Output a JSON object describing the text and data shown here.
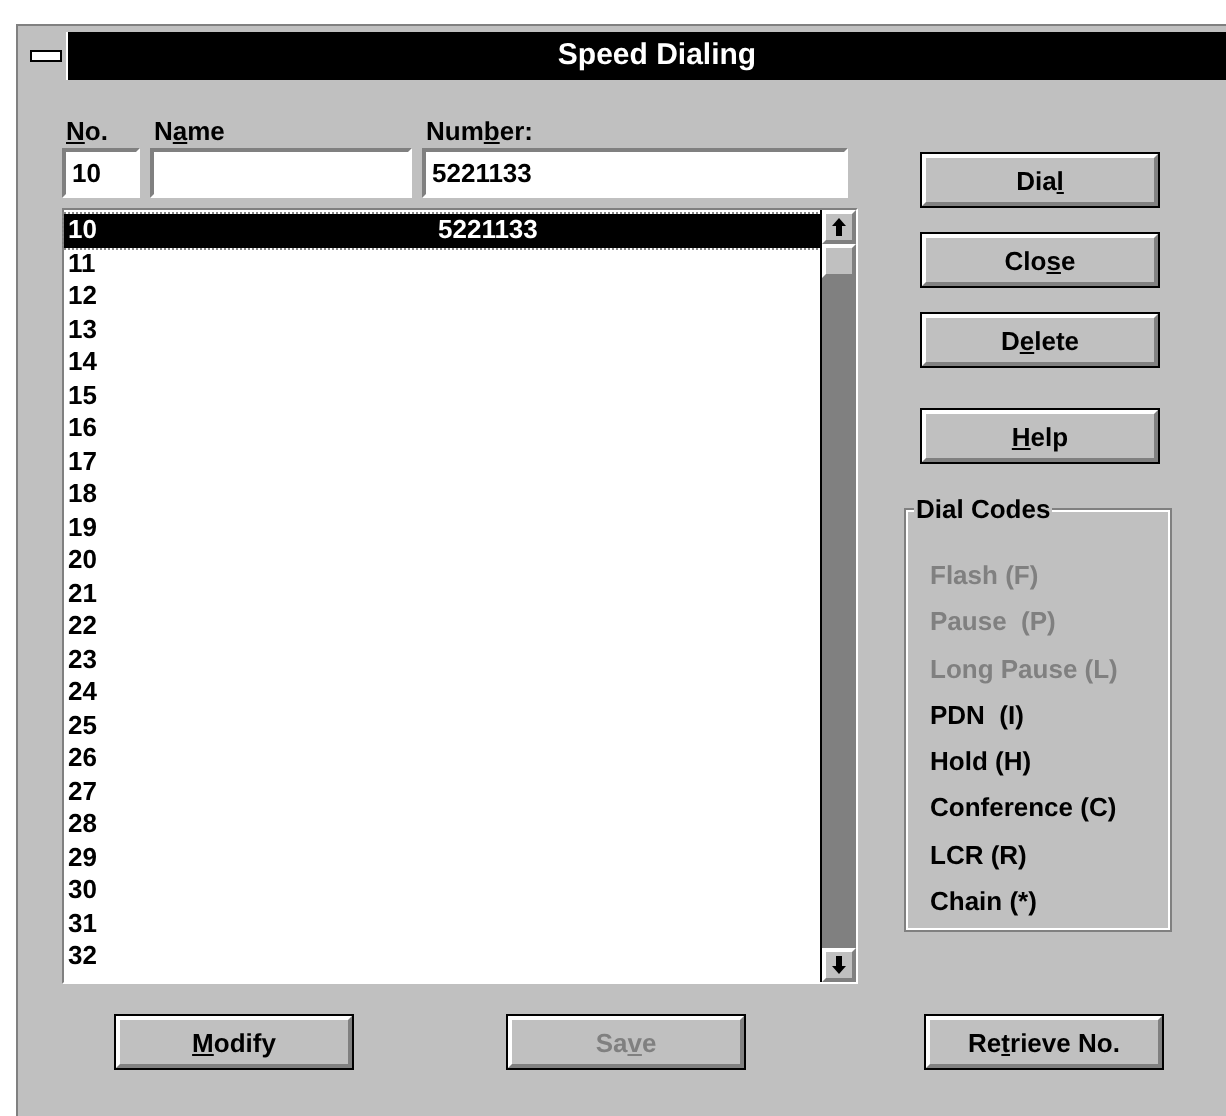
{
  "window": {
    "title": "Speed Dialing"
  },
  "fields": [
    {
      "label": {
        "key": "N",
        "post": "o."
      },
      "value": "10"
    },
    {
      "label": {
        "pre": "N",
        "key": "a",
        "post": "me"
      }
    },
    {
      "label": {
        "pre": "Num",
        "key": "b",
        "post": "er:"
      },
      "value": "5221133"
    }
  ],
  "list": {
    "rows": [
      {
        "no": "10",
        "number": "5221133",
        "selected": true
      },
      {
        "no": "11",
        "selected": false
      },
      {
        "no": "12",
        "selected": false
      },
      {
        "no": "13",
        "selected": false
      },
      {
        "no": "14",
        "selected": false
      },
      {
        "no": "15",
        "selected": false
      },
      {
        "no": "16",
        "selected": false
      },
      {
        "no": "17",
        "selected": false
      },
      {
        "no": "18",
        "selected": false
      },
      {
        "no": "19",
        "selected": false
      },
      {
        "no": "20",
        "selected": false
      },
      {
        "no": "21",
        "selected": false
      },
      {
        "no": "22",
        "selected": false
      },
      {
        "no": "23",
        "selected": false
      },
      {
        "no": "24",
        "selected": false
      },
      {
        "no": "25",
        "selected": false
      },
      {
        "no": "26",
        "selected": false
      },
      {
        "no": "27",
        "selected": false
      },
      {
        "no": "28",
        "selected": false
      },
      {
        "no": "29",
        "selected": false
      },
      {
        "no": "30",
        "selected": false
      },
      {
        "no": "31",
        "selected": false
      },
      {
        "no": "32",
        "selected": false
      }
    ]
  },
  "side_buttons": [
    {
      "pre": "Dia",
      "key": "l",
      "disabled": false
    },
    {
      "pre": "Clo",
      "key": "s",
      "post": "e",
      "disabled": false
    },
    {
      "pre": "D",
      "key": "e",
      "post": "lete",
      "disabled": false
    },
    {
      "key": "H",
      "post": "elp",
      "disabled": false
    }
  ],
  "dial_codes": {
    "title": "Dial Codes",
    "items": [
      {
        "label": "Flash (F)",
        "disabled": true
      },
      {
        "label": "Pause  (P)",
        "disabled": true
      },
      {
        "label": "Long Pause (L)",
        "disabled": true
      },
      {
        "label": "PDN  (I)",
        "disabled": false
      },
      {
        "label": "Hold (H)",
        "disabled": false
      },
      {
        "label": "Conference (C)",
        "disabled": false
      },
      {
        "label": "LCR (R)",
        "disabled": false
      },
      {
        "label": "Chain (*)",
        "disabled": false
      }
    ]
  },
  "bottom_buttons": [
    {
      "key": "M",
      "post": "odify",
      "disabled": false
    },
    {
      "pre": "Sa",
      "key": "v",
      "post": "e",
      "disabled": true
    },
    {
      "pre": "Re",
      "key": "t",
      "post": "rieve No.",
      "disabled": false
    }
  ]
}
